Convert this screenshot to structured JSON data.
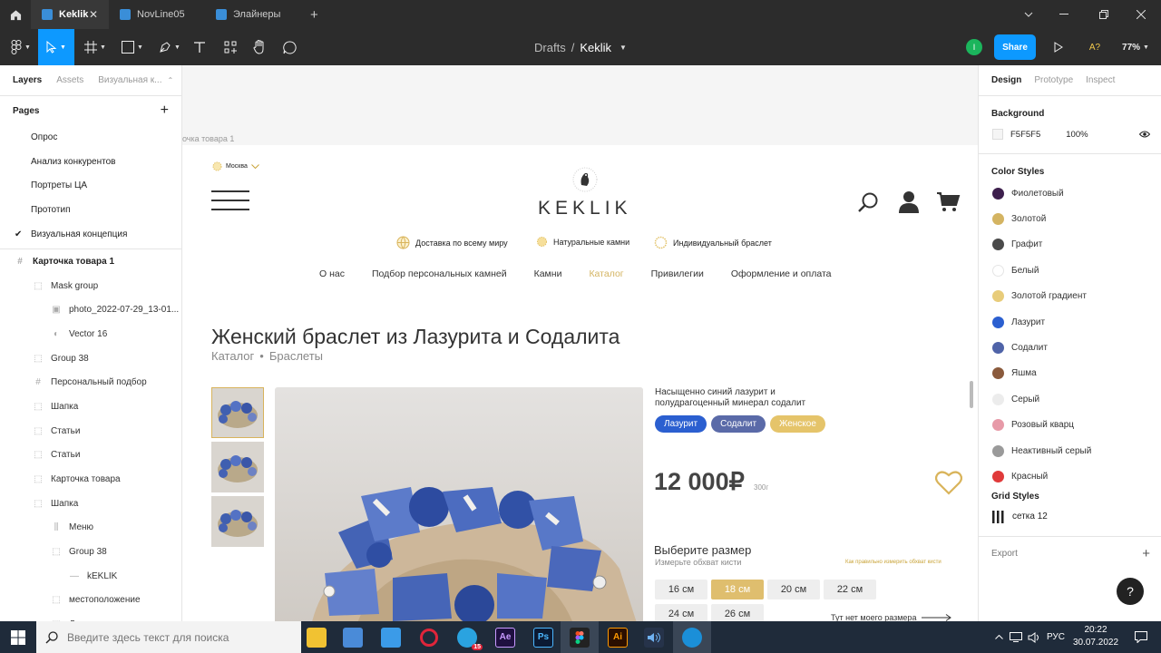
{
  "tabs": [
    {
      "label": "Keklik",
      "close": "✕"
    },
    {
      "label": "NovLine05"
    },
    {
      "label": "Элайнеры"
    }
  ],
  "tabs_add": "+",
  "breadcrumb": {
    "root": "Drafts",
    "sep": "/",
    "current": "Keklik"
  },
  "toolbar": {
    "avatar": "I",
    "share": "Share",
    "aa": "A?",
    "zoom": "77%"
  },
  "left": {
    "tabs": [
      "Layers",
      "Assets",
      "Визуальная к..."
    ],
    "pages_title": "Pages",
    "add": "+",
    "pages": [
      "Опрос",
      "Анализ конкурентов",
      "Портреты ЦА",
      "Прототип",
      "Визуальная концепция"
    ],
    "current_page_check": "✔",
    "layers": [
      {
        "label": "Карточка товара 1",
        "icon": "#",
        "indent": 0,
        "frame": true
      },
      {
        "label": "Mask group",
        "icon": "⬚",
        "indent": 1
      },
      {
        "label": "photo_2022-07-29_13-01...",
        "icon": "▣",
        "indent": 2
      },
      {
        "label": "Vector 16",
        "icon": "◐",
        "indent": 2
      },
      {
        "label": "Group 38",
        "icon": "⬚",
        "indent": 1
      },
      {
        "label": "Персональный подбор",
        "icon": "#",
        "indent": 1
      },
      {
        "label": "Шапка",
        "icon": "⬚",
        "indent": 1
      },
      {
        "label": "Статьи",
        "icon": "⬚",
        "indent": 1
      },
      {
        "label": "Статьи",
        "icon": "⬚",
        "indent": 1
      },
      {
        "label": "Карточка товара",
        "icon": "⬚",
        "indent": 1
      },
      {
        "label": "Шапка",
        "icon": "⬚",
        "indent": 1
      },
      {
        "label": "Меню",
        "icon": "⫼",
        "indent": 2
      },
      {
        "label": "Group 38",
        "icon": "⬚",
        "indent": 2
      },
      {
        "label": "kEKLIK",
        "icon": "—",
        "indent": 3
      },
      {
        "label": "местоположение",
        "icon": "⬚",
        "indent": 2
      },
      {
        "label": "Доставка по всему миру",
        "icon": "⬚",
        "indent": 2
      }
    ]
  },
  "canvas": {
    "frame_label": "очка товара 1",
    "bg_color": "#f5f5f5"
  },
  "site": {
    "city": "Москва",
    "logo": "KEKLIK",
    "features": [
      "Доставка по всему миру",
      "Натуральные камни",
      "Индивидуальный браслет"
    ],
    "nav": [
      "О нас",
      "Подбор персональных камней",
      "Камни",
      "Каталог",
      "Привилегии",
      "Оформление и оплата"
    ],
    "nav_active": "Каталог",
    "title": "Женский браслет из Лазурита и Содалита",
    "crumb_a": "Каталог",
    "crumb_sep": "•",
    "crumb_b": "Браслеты",
    "desc": "Насыщенно синий лазурит и полудрагоценный минерал содалит",
    "tags": [
      {
        "label": "Лазурит",
        "color": "#2b5fd0"
      },
      {
        "label": "Содалит",
        "color": "#5a6aa8"
      },
      {
        "label": "Женское",
        "color": "#e5c46a"
      }
    ],
    "price": "12 000₽",
    "weight": "300г",
    "size_title": "Выберите размер",
    "size_sub": "Измерьте обхват кисти",
    "size_link": "Как правильно измерить обхват кисти",
    "sizes": [
      "16 см",
      "18 см",
      "20 см",
      "22 см",
      "24 см",
      "26 см"
    ],
    "size_selected": "18 см",
    "no_size": "Тут нет моего размера"
  },
  "right": {
    "tabs": [
      "Design",
      "Prototype",
      "Inspect"
    ],
    "background_title": "Background",
    "bg_hex": "F5F5F5",
    "bg_opacity": "100%",
    "color_styles_title": "Color Styles",
    "colors": [
      {
        "name": "Фиолетовый",
        "hex": "#3d1f4d"
      },
      {
        "name": "Золотой",
        "hex": "#d4b462"
      },
      {
        "name": "Графит",
        "hex": "#4a4a4a"
      },
      {
        "name": "Белый",
        "hex": "#ffffff"
      },
      {
        "name": "Золотой градиент",
        "hex": "#e8cc7a"
      },
      {
        "name": "Лазурит",
        "hex": "#2b5fd0"
      },
      {
        "name": "Содалит",
        "hex": "#4f63a8"
      },
      {
        "name": "Яшма",
        "hex": "#8a5a3c"
      },
      {
        "name": "Серый",
        "hex": "#ececec"
      },
      {
        "name": "Розовый кварц",
        "hex": "#e79aa8"
      },
      {
        "name": "Неактивный серый",
        "hex": "#9a9a9a"
      },
      {
        "name": "Красный",
        "hex": "#e03a3a"
      }
    ],
    "grid_styles_title": "Grid Styles",
    "grid_item": "сетка 12",
    "export_title": "Export",
    "export_add": "+",
    "help": "?"
  },
  "taskbar": {
    "search_placeholder": "Введите здесь текст для поиска",
    "badge": "15",
    "lang": "РУС",
    "time": "20:22",
    "date": "30.07.2022"
  }
}
